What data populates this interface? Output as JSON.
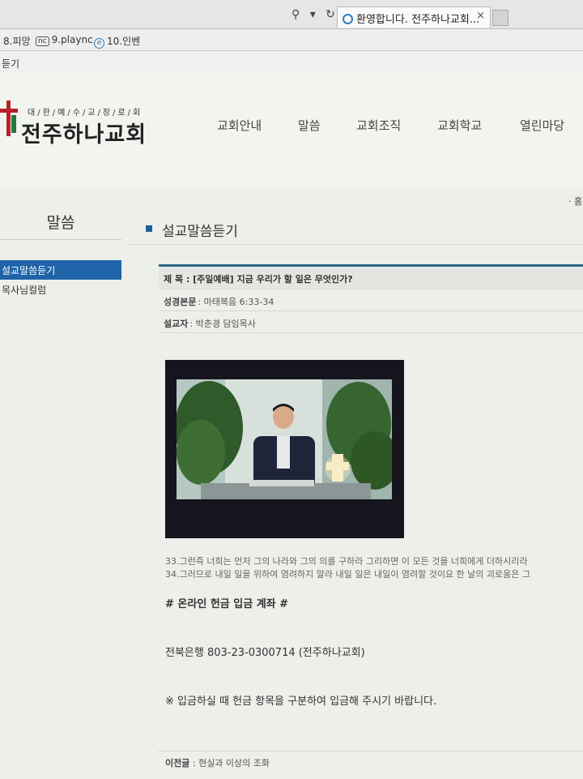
{
  "browser": {
    "tab_title": "환영합니다. 전주하나교회...",
    "tab_close": "×",
    "address_tools": "⚲ ▾ ↻",
    "favorites": [
      {
        "label": "8.피망"
      },
      {
        "label": "9.plaync",
        "badge": "nc"
      },
      {
        "label": "10.인벤",
        "badge": "e"
      }
    ],
    "cmd_text": "듣기"
  },
  "site": {
    "logo_sub": "대/한/예/수/교/장/로/회",
    "logo_name": "전주하나교회",
    "nav": [
      "교회안내",
      "말씀",
      "교회조직",
      "교회학교",
      "열린마당"
    ]
  },
  "sidebar": {
    "title": "말씀",
    "items": [
      {
        "label": "설교말씀듣기",
        "active": true
      },
      {
        "label": "목사님컬럼",
        "active": false
      }
    ]
  },
  "breadcrumb": {
    "home": "· 홈"
  },
  "page": {
    "title": "설교말씀듣기"
  },
  "sermon": {
    "title_label": "제   목 :",
    "title": "[주일예배] 지금 우리가 할 일은 무엇인가?",
    "scripture_label": "성경본문",
    "scripture": ": 마태복음 6:33-34",
    "preacher_label": "설교자",
    "preacher": ": 박춘경 담임목사"
  },
  "verses": [
    "33.그런즉 너희는 먼저 그의 나라와 그의 의를 구하라 그리하면 이 모든 것을 너희에게 더하시리라",
    "34.그러므로 내일 일을 위하여 염려하지 말라 내일 일은 내일이 염려할 것이요 한 날의 괴로움은 그"
  ],
  "offering": {
    "heading": "# 온라인 헌금 입금 계좌 #",
    "account": "전북은행  803-23-0300714 (전주하나교회)",
    "note": "※ 입금하실 때 헌금 항목을 구분하여 입금해 주시기 바랍니다."
  },
  "prev_post": {
    "label": "이전글",
    "title": ": 현실과 이상의 조화"
  }
}
